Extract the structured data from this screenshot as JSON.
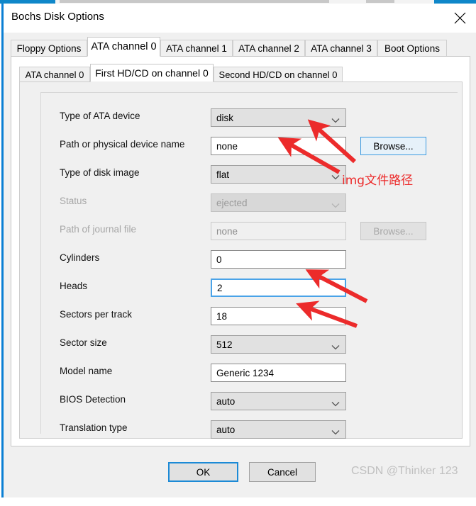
{
  "window": {
    "title": "Bochs Disk Options",
    "close_icon": "close-icon"
  },
  "outer_tabs": [
    {
      "label": "Floppy Options",
      "selected": false
    },
    {
      "label": "ATA channel 0",
      "selected": true
    },
    {
      "label": "ATA channel 1",
      "selected": false
    },
    {
      "label": "ATA channel 2",
      "selected": false
    },
    {
      "label": "ATA channel 3",
      "selected": false
    },
    {
      "label": "Boot Options",
      "selected": false
    }
  ],
  "inner_tabs": [
    {
      "label": "ATA channel 0",
      "selected": false
    },
    {
      "label": "First HD/CD on channel 0",
      "selected": true
    },
    {
      "label": "Second HD/CD on channel 0",
      "selected": false
    }
  ],
  "form": {
    "rows": [
      {
        "label": "Type of ATA device",
        "value": "disk",
        "kind": "combo",
        "disabled": false,
        "focused": false
      },
      {
        "label": "Path or physical device name",
        "value": "none",
        "kind": "text",
        "disabled": false,
        "focused": false
      },
      {
        "label": "Type of disk image",
        "value": "flat",
        "kind": "combo",
        "disabled": false,
        "focused": false
      },
      {
        "label": "Status",
        "value": "ejected",
        "kind": "combo",
        "disabled": true,
        "focused": false
      },
      {
        "label": "Path of journal file",
        "value": "none",
        "kind": "text",
        "disabled": true,
        "focused": false
      },
      {
        "label": "Cylinders",
        "value": "0",
        "kind": "text",
        "disabled": false,
        "focused": false
      },
      {
        "label": "Heads",
        "value": "2",
        "kind": "text",
        "disabled": false,
        "focused": true
      },
      {
        "label": "Sectors per track",
        "value": "18",
        "kind": "text",
        "disabled": false,
        "focused": false
      },
      {
        "label": "Sector size",
        "value": "512",
        "kind": "combo",
        "disabled": false,
        "focused": false
      },
      {
        "label": "Model name",
        "value": "Generic 1234",
        "kind": "text",
        "disabled": false,
        "focused": false
      },
      {
        "label": "BIOS Detection",
        "value": "auto",
        "kind": "combo",
        "disabled": false,
        "focused": false
      },
      {
        "label": "Translation type",
        "value": "auto",
        "kind": "combo",
        "disabled": false,
        "focused": false
      }
    ],
    "browse_device": {
      "label": "Browse...",
      "disabled": false
    },
    "browse_journal": {
      "label": "Browse...",
      "disabled": true
    }
  },
  "buttons": {
    "ok": "OK",
    "cancel": "Cancel"
  },
  "watermark": "CSDN @Thinker 123",
  "annotation": {
    "text": "img文件路径",
    "color": "#ec2b2b"
  },
  "colors": {
    "accent_blue": "#0a7fd4",
    "focus_blue": "#4aa3e8",
    "annotation_red": "#ec2b2b",
    "dialog_bg": "#f0f0f0"
  }
}
